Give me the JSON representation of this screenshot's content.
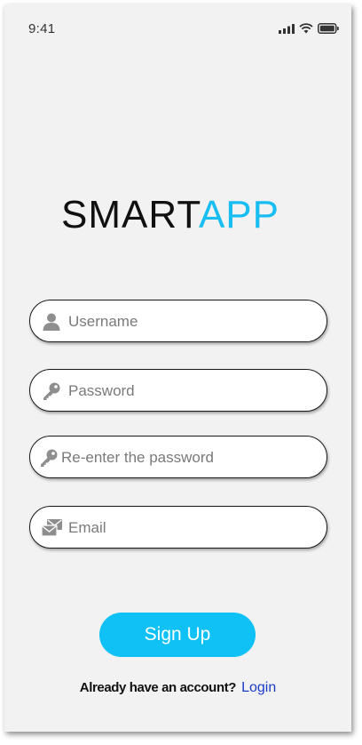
{
  "status_bar": {
    "time": "9:41",
    "icons": [
      "signal-icon",
      "wifi-icon",
      "battery-icon"
    ]
  },
  "logo": {
    "part1": "SMART",
    "part2": "APP"
  },
  "form": {
    "username": {
      "placeholder": "Username",
      "value": "",
      "icon": "user-icon"
    },
    "password": {
      "placeholder": "Password",
      "value": "",
      "icon": "key-icon"
    },
    "confirm_password": {
      "placeholder": "Re-enter the password",
      "value": "",
      "icon": "key-icon"
    },
    "email": {
      "placeholder": "Email",
      "value": "",
      "icon": "mail-icon"
    }
  },
  "signup_button": {
    "label": "Sign Up"
  },
  "footer": {
    "question": "Already have an account?",
    "login_link": "Login"
  },
  "colors": {
    "accent": "#0fc1f5",
    "logo_accent": "#18bdf2",
    "link": "#1a3cc8",
    "background": "#f2f2f2"
  }
}
